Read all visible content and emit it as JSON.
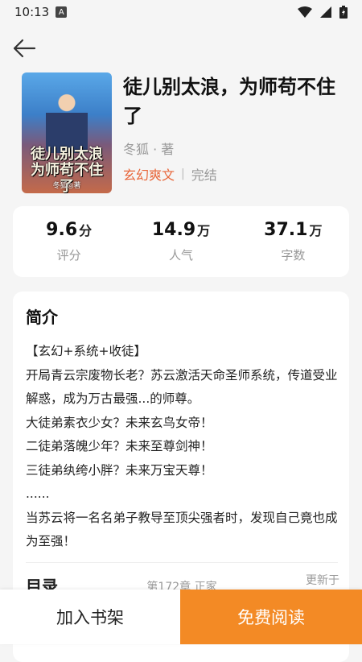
{
  "status_bar": {
    "time": "10:13",
    "notification_letter": "A"
  },
  "book": {
    "title": "徒儿别太浪，为师苟不住了",
    "author": "冬狐 · 著",
    "genre": "玄幻爽文",
    "separator": "|",
    "status": "完结",
    "cover": {
      "title": "徒儿别太浪为师苟不住了",
      "author": "冬狐◎著"
    }
  },
  "stats": [
    {
      "value": "9.6",
      "unit": "分",
      "label": "评分"
    },
    {
      "value": "14.9",
      "unit": "万",
      "label": "人气"
    },
    {
      "value": "37.1",
      "unit": "万",
      "label": "字数"
    }
  ],
  "intro": {
    "heading": "简介",
    "lines": [
      "【玄幻+系统+收徒】",
      "开局青云宗废物长老？苏云激活天命圣师系统，传道受业解惑，成为万古最强...的师尊。",
      "大徒弟素衣少女？未来玄鸟女帝！",
      "二徒弟落魄少年？未来至尊剑神！",
      "三徒弟纨绔小胖？未来万宝天尊！",
      "......",
      "当苏云将一名名弟子教导至顶尖强者时，发现自己竟也成为至强！"
    ]
  },
  "catalog": {
    "title": "目录",
    "info": "第172章 正家",
    "update": "更新于"
  },
  "actions": {
    "add_shelf": "加入书架",
    "free_read": "免费阅读"
  },
  "colors": {
    "accent": "#f38a25",
    "genre": "#e8663a"
  }
}
